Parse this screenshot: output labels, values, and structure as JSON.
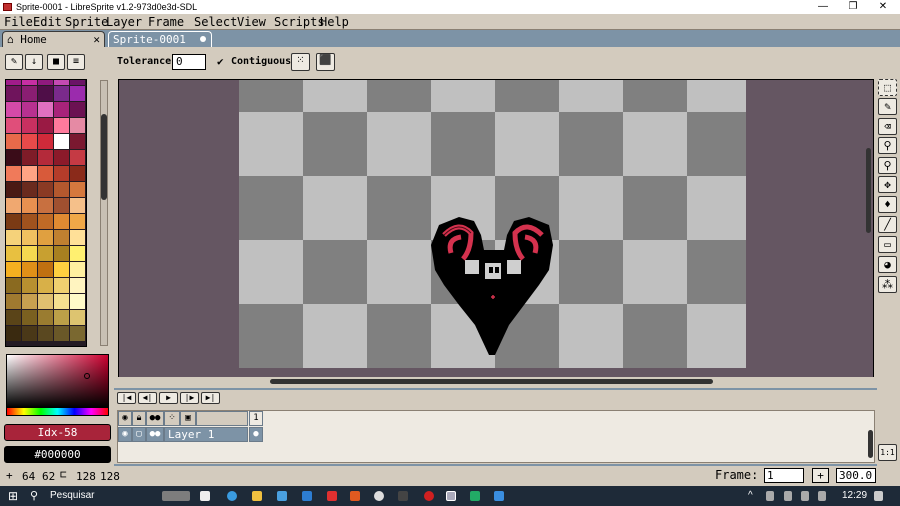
{
  "window": {
    "title": "Sprite-0001 - LibreSprite v1.2-973d0e3d-SDL"
  },
  "menubar": {
    "items": [
      "File",
      "Edit",
      "Sprite",
      "Layer",
      "Frame",
      "Select",
      "View",
      "Scripts",
      "Help"
    ]
  },
  "tabs": {
    "home": "Home",
    "sprite": "Sprite-0001"
  },
  "context_bar": {
    "tolerance_label": "Tolerance:",
    "tolerance_value": "0",
    "contiguous_label": "Contiguous"
  },
  "colors": {
    "foreground_label": "Idx-58",
    "background_label": "#000000",
    "foreground_hex": "#a8243a",
    "background_hex": "#000000"
  },
  "timeline": {
    "frame_number": "1",
    "layer_name": "Layer 1"
  },
  "statusbar": {
    "cursor_x": "64",
    "cursor_y": "62",
    "sprite_w": "128",
    "sprite_h": "128",
    "frame_label": "Frame:",
    "frame_value": "1",
    "zoom": "300.0",
    "plus": "+",
    "one_to_one": "1:1"
  },
  "taskbar": {
    "search_placeholder": "Pesquisar",
    "clock": "12:29"
  },
  "icons": [
    "home-icon",
    "close-icon",
    "pin-icon",
    "eye-icon",
    "lock-icon",
    "link-icon",
    "onion-skin-icon",
    "pencil-icon",
    "eraser-icon",
    "eyedropper-icon",
    "zoom-icon",
    "move-icon",
    "fill-icon",
    "line-icon",
    "rectangle-icon",
    "ellipse-icon",
    "blur-icon",
    "marquee-icon",
    "windows-start-icon"
  ]
}
